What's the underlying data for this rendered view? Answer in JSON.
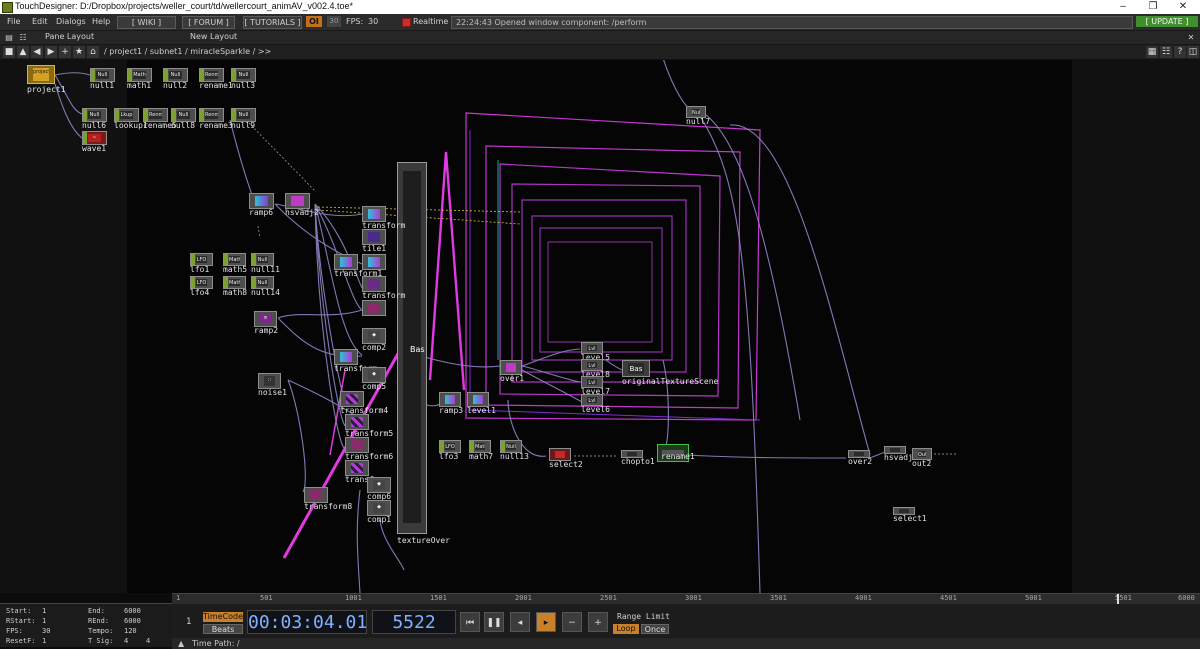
{
  "app": {
    "title": "TouchDesigner: D:/Dropbox/projects/weller_court/td/wellercourt_animAV_v002.4.toe*",
    "min_icon": "minimize-icon",
    "max_icon": "maximize-icon",
    "close_icon": "close-icon"
  },
  "menubar": {
    "menus": [
      "File",
      "Edit",
      "Dialogs",
      "Help"
    ],
    "wiki": "[ WIKI ]",
    "forum": "[ FORUM ]",
    "tutorials": "[ TUTORIALS ]",
    "oi": "OI",
    "fps_badge": "30",
    "fps_label": "FPS:",
    "fps_value": "30",
    "realtime": "Realtime",
    "status": "22:24:43 Opened window component: /perform",
    "update": "[ UPDATE ]"
  },
  "panebar": {
    "pane_layout": "Pane Layout",
    "new_layout": "New Layout"
  },
  "pathbar": {
    "path": "/ project1 / subnet1 / miracleSparkle / >>"
  },
  "nodes": {
    "project1": "project1",
    "null1": "null1",
    "math1": "math1",
    "null2": "null2",
    "rename1": "rename1",
    "null3": "null3",
    "null6": "null6",
    "lookup1": "lookup1",
    "rename5": "rename5",
    "null8": "null8",
    "rename3": "rename3",
    "null9": "null9",
    "wave1": "wave1",
    "ramp6": "ramp6",
    "hsvadj2": "hsvadj2",
    "lfo1": "lfo1",
    "math5": "math5",
    "null11": "null11",
    "lfo4": "lfo4",
    "math8": "math8",
    "null14": "null14",
    "ramp2": "ramp2",
    "noise1": "noise1",
    "transform": "transform",
    "tile1": "tile1",
    "transform1": "transform1",
    "transform_b": "transform",
    "transform_c": "transform",
    "comp2": "comp2",
    "transform_d": "transform",
    "comp5": "comp5",
    "transform4": "transform4",
    "transform5": "transform5",
    "transform6": "transform6",
    "transform_e": "transform",
    "comp6": "comp6",
    "comp1": "comp1",
    "transform8": "transform8",
    "textureOver": "textureOver",
    "textureOver_tag": "Bas",
    "over1": "over1",
    "level5": "level5",
    "level8": "level8",
    "level7": "level7",
    "level6": "level6",
    "originalTextureScene": "originalTextureScene",
    "originalTextureScene_tag": "Bas",
    "ramp3": "ramp3",
    "level1": "level1",
    "lfo3": "lfo3",
    "math7": "math7",
    "null13": "null13",
    "select2": "select2",
    "chopto1": "chopto1",
    "rename1b": "rename1",
    "over2": "over2",
    "hsvadj1": "hsvadj1",
    "out2": "out2",
    "null7": "null7",
    "select1": "select1"
  },
  "tile_glyphs": {
    "null": "Null",
    "math": "Math",
    "rename": "Renm",
    "out": "Out",
    "level": "Lvl"
  },
  "timeline": {
    "ticks": [
      "1",
      "501",
      "1001",
      "1501",
      "2001",
      "2501",
      "3001",
      "3501",
      "4001",
      "4501",
      "5001",
      "5501",
      "6000"
    ]
  },
  "info": {
    "start_label": "Start:",
    "start": "1",
    "end_label": "End:",
    "end": "6000",
    "rstart_label": "RStart:",
    "rstart": "1",
    "rend_label": "REnd:",
    "rend": "6000",
    "fps_label": "FPS:",
    "fps": "30",
    "tempo_label": "Tempo:",
    "tempo": "120",
    "resetf_label": "ResetF:",
    "resetf": "1",
    "tsig_label": "T Sig:",
    "tsig_a": "4",
    "tsig_b": "4"
  },
  "transport": {
    "one": "1",
    "timecode": "TimeCode",
    "beats": "Beats",
    "time": "00:03:04.01",
    "frame": "5522",
    "range_limit": "Range Limit",
    "loop": "Loop",
    "once": "Once",
    "time_path": "Time Path: /"
  },
  "colors": {
    "accent": "#c9802a",
    "update": "#3f8f2c",
    "wire": "#8f86c9",
    "pink": "#e03be0"
  }
}
